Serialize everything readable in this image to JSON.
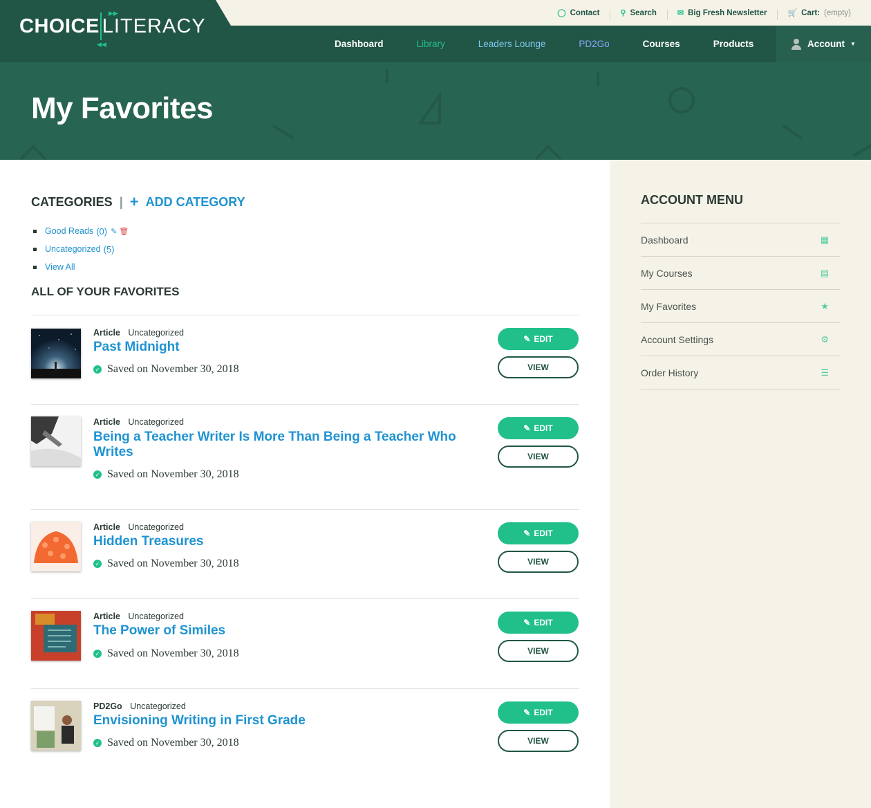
{
  "utility": {
    "contact": "Contact",
    "search": "Search",
    "newsletter": "Big Fresh Newsletter",
    "cart_label": "Cart:",
    "cart_value": "(empty)"
  },
  "logo": {
    "bold": "CHOICE",
    "light": "LITERACY"
  },
  "nav": {
    "dashboard": "Dashboard",
    "library": "Library",
    "leaders": "Leaders Lounge",
    "pd2go": "PD2Go",
    "courses": "Courses",
    "products": "Products",
    "account": "Account"
  },
  "hero": {
    "title": "My Favorites"
  },
  "categories": {
    "heading": "CATEGORIES",
    "separator": "|",
    "add": "ADD CATEGORY",
    "items": [
      {
        "label": "Good Reads",
        "count": "(0)"
      },
      {
        "label": "Uncategorized",
        "count": "(5)"
      },
      {
        "label": "View All",
        "count": ""
      }
    ]
  },
  "favorites": {
    "heading": "ALL OF YOUR FAVORITES",
    "edit_label": "EDIT",
    "view_label": "VIEW",
    "items": [
      {
        "type": "Article",
        "category": "Uncategorized",
        "title": "Past Midnight",
        "saved": "Saved on November 30, 2018"
      },
      {
        "type": "Article",
        "category": "Uncategorized",
        "title": "Being a Teacher Writer Is More Than Being a Teacher Who Writes",
        "saved": "Saved on November 30, 2018"
      },
      {
        "type": "Article",
        "category": "Uncategorized",
        "title": "Hidden Treasures",
        "saved": "Saved on November 30, 2018"
      },
      {
        "type": "Article",
        "category": "Uncategorized",
        "title": "The Power of Similes",
        "saved": "Saved on November 30, 2018"
      },
      {
        "type": "PD2Go",
        "category": "Uncategorized",
        "title": "Envisioning Writing in First Grade",
        "saved": "Saved on November 30, 2018"
      }
    ]
  },
  "sidebar": {
    "heading": "ACCOUNT MENU",
    "items": [
      {
        "label": "Dashboard",
        "icon": "grid-icon"
      },
      {
        "label": "My Courses",
        "icon": "book-icon"
      },
      {
        "label": "My Favorites",
        "icon": "star-icon"
      },
      {
        "label": "Account Settings",
        "icon": "gear-icon"
      },
      {
        "label": "Order History",
        "icon": "list-icon"
      }
    ]
  },
  "colors": {
    "brand_dark": "#215545",
    "hero": "#286452",
    "accent_green": "#21c08b",
    "link_blue": "#1f93d1",
    "cream": "#f5f3e8"
  }
}
